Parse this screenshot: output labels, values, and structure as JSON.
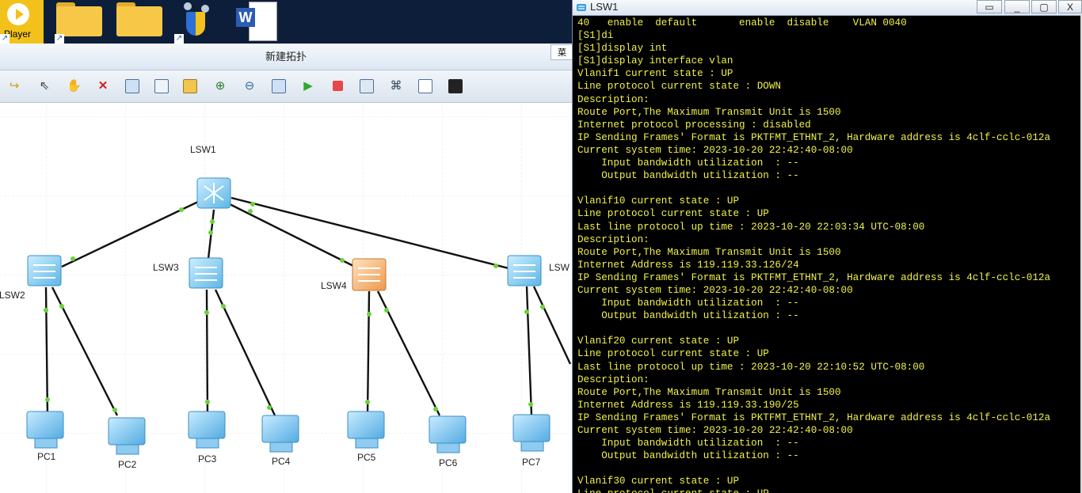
{
  "desktop": {
    "icons": [
      {
        "name": "player-shortcut",
        "label": "Player"
      },
      {
        "name": "folder-1",
        "label": ""
      },
      {
        "name": "folder-2",
        "label": ""
      },
      {
        "name": "ensp-shortcut",
        "label": ""
      },
      {
        "name": "word-document",
        "label": ""
      }
    ]
  },
  "topology": {
    "title": "新建拓扑",
    "side_tab": "菜",
    "toolbar": [
      "undo-icon",
      "select-pointer-icon",
      "pan-hand-icon",
      "delete-icon",
      "delete-link-icon",
      "text-note-icon",
      "rectangle-icon",
      "zoom-in-icon",
      "zoom-out-icon",
      "fit-view-icon",
      "start-device-icon",
      "stop-device-icon",
      "capture-icon",
      "topology-icon",
      "grid-icon",
      "screenshot-icon"
    ],
    "devices": [
      {
        "id": "lsw1",
        "label": "LSW1",
        "kind": "core-switch"
      },
      {
        "id": "lsw2",
        "label": "LSW2",
        "kind": "switch"
      },
      {
        "id": "lsw3",
        "label": "LSW3",
        "kind": "switch"
      },
      {
        "id": "lsw4",
        "label": "LSW4",
        "kind": "switch-orange"
      },
      {
        "id": "lsw5",
        "label": "LSW",
        "kind": "switch"
      },
      {
        "id": "pc1",
        "label": "PC1",
        "kind": "pc"
      },
      {
        "id": "pc2",
        "label": "PC2",
        "kind": "pc"
      },
      {
        "id": "pc3",
        "label": "PC3",
        "kind": "pc"
      },
      {
        "id": "pc4",
        "label": "PC4",
        "kind": "pc"
      },
      {
        "id": "pc5",
        "label": "PC5",
        "kind": "pc"
      },
      {
        "id": "pc6",
        "label": "PC6",
        "kind": "pc"
      },
      {
        "id": "pc7",
        "label": "PC7",
        "kind": "pc"
      }
    ],
    "colors": {
      "link": "#111111",
      "port": "#6ad23a",
      "grid": "#e0e4ea"
    }
  },
  "console": {
    "title": "LSW1",
    "buttons": [
      "▭",
      "_",
      "▢",
      "X"
    ],
    "lines": [
      "40   enable  default       enable  disable    VLAN 0040",
      "[S1]di",
      "[S1]display int",
      "[S1]display interface vlan",
      "Vlanif1 current state : UP",
      "Line protocol current state : DOWN",
      "Description:",
      "Route Port,The Maximum Transmit Unit is 1500",
      "Internet protocol processing : disabled",
      "IP Sending Frames' Format is PKTFMT_ETHNT_2, Hardware address is 4clf-cclc-012a",
      "Current system time: 2023-10-20 22:42:40-08:00",
      "    Input bandwidth utilization  : --",
      "    Output bandwidth utilization : --",
      "",
      "Vlanif10 current state : UP",
      "Line protocol current state : UP",
      "Last line protocol up time : 2023-10-20 22:03:34 UTC-08:00",
      "Description:",
      "Route Port,The Maximum Transmit Unit is 1500",
      "Internet Address is 119.119.33.126/24",
      "IP Sending Frames' Format is PKTFMT_ETHNT_2, Hardware address is 4clf-cclc-012a",
      "Current system time: 2023-10-20 22:42:40-08:00",
      "    Input bandwidth utilization  : --",
      "    Output bandwidth utilization : --",
      "",
      "Vlanif20 current state : UP",
      "Line protocol current state : UP",
      "Last line protocol up time : 2023-10-20 22:10:52 UTC-08:00",
      "Description:",
      "Route Port,The Maximum Transmit Unit is 1500",
      "Internet Address is 119.119.33.190/25",
      "IP Sending Frames' Format is PKTFMT_ETHNT_2, Hardware address is 4clf-cclc-012a",
      "Current system time: 2023-10-20 22:42:40-08:00",
      "    Input bandwidth utilization  : --",
      "    Output bandwidth utilization : --",
      "",
      "Vlanif30 current state : UP",
      "Line protocol current state : UP"
    ]
  }
}
